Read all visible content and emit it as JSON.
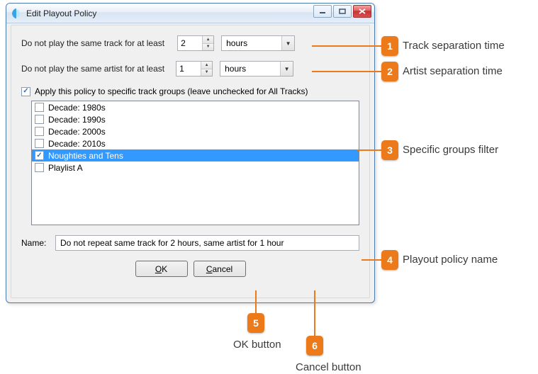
{
  "window": {
    "title": "Edit Playout Policy"
  },
  "track_row": {
    "label": "Do not play the same track for at least",
    "value": "2",
    "unit": "hours"
  },
  "artist_row": {
    "label": "Do not play the same artist for at least",
    "value": "1",
    "unit": "hours"
  },
  "apply_row": {
    "checked": true,
    "label": "Apply this policy to specific track groups (leave unchecked for All Tracks)"
  },
  "groups": [
    {
      "label": "Decade: 1980s",
      "checked": false,
      "selected": false
    },
    {
      "label": "Decade: 1990s",
      "checked": false,
      "selected": false
    },
    {
      "label": "Decade: 2000s",
      "checked": false,
      "selected": false
    },
    {
      "label": "Decade: 2010s",
      "checked": false,
      "selected": false
    },
    {
      "label": "Noughties and Tens",
      "checked": true,
      "selected": true
    },
    {
      "label": "Playlist A",
      "checked": false,
      "selected": false
    }
  ],
  "name_row": {
    "label": "Name:",
    "value": "Do not repeat same track for 2 hours, same artist for 1 hour"
  },
  "buttons": {
    "ok": "OK",
    "cancel": "Cancel"
  },
  "callouts": {
    "c1": "Track separation time",
    "c2": "Artist separation time",
    "c3": "Specific groups filter",
    "c4": "Playout policy name",
    "c5": "OK button",
    "c6": "Cancel button"
  }
}
